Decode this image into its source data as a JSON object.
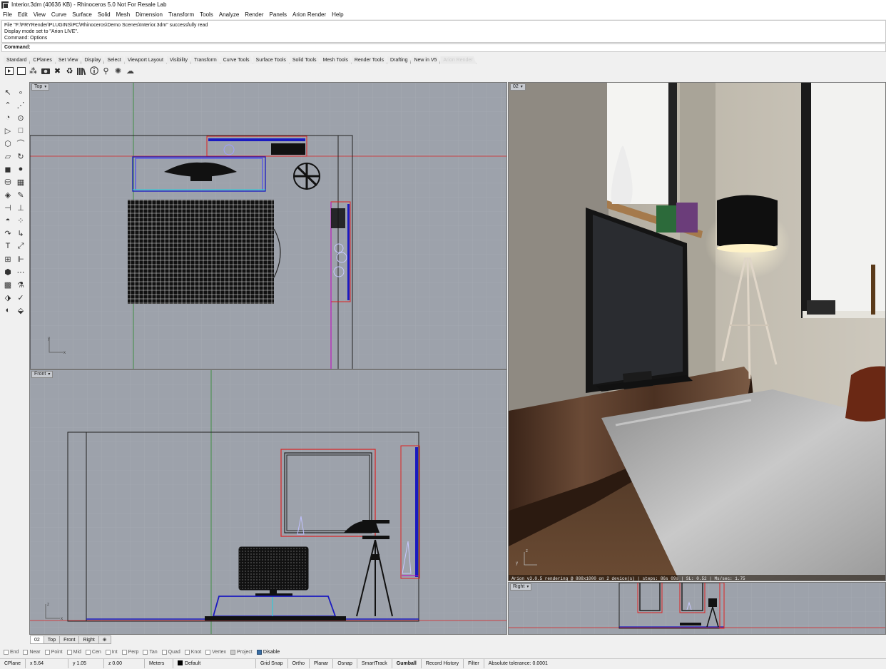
{
  "window": {
    "title": "Interior.3dm (40636 KB) - Rhinoceros 5.0 Not For Resale Lab"
  },
  "menu": [
    "File",
    "Edit",
    "View",
    "Curve",
    "Surface",
    "Solid",
    "Mesh",
    "Dimension",
    "Transform",
    "Tools",
    "Analyze",
    "Render",
    "Panels",
    "Arion Render",
    "Help"
  ],
  "command_history": [
    "File \"F:\\FRYRender\\PLUGINS\\PC\\Rhinoceros\\Demo Scenes\\Interior.3dm\" successfully read",
    "Display mode set to \"Arion LIVE\".",
    "Command: Options"
  ],
  "command_prompt": "Command:",
  "toolbar_tabs": [
    "Standard",
    "CPlanes",
    "Set View",
    "Display",
    "Select",
    "Viewport Layout",
    "Visibility",
    "Transform",
    "Curve Tools",
    "Surface Tools",
    "Solid Tools",
    "Mesh Tools",
    "Render Tools",
    "Drafting",
    "New in V5",
    "Arion Render"
  ],
  "viewports": {
    "top": {
      "label": "Top"
    },
    "front": {
      "label": "Front"
    },
    "perspective": {
      "label": "02"
    },
    "right": {
      "label": "Right"
    }
  },
  "render_status": "Arion v3.0.5 rendering @ 888x1000 on 2 device(s) | steps: 86s 09s | SL: 0.52 | Ms/sec: 1.75",
  "viewport_tabs": [
    "02",
    "Top",
    "Front",
    "Right"
  ],
  "osnaps": [
    {
      "label": "End",
      "on": false
    },
    {
      "label": "Near",
      "on": false
    },
    {
      "label": "Point",
      "on": false
    },
    {
      "label": "Mid",
      "on": false
    },
    {
      "label": "Cen",
      "on": false
    },
    {
      "label": "Int",
      "on": false
    },
    {
      "label": "Perp",
      "on": false
    },
    {
      "label": "Tan",
      "on": false
    },
    {
      "label": "Quad",
      "on": false
    },
    {
      "label": "Knot",
      "on": false
    },
    {
      "label": "Vertex",
      "on": false
    },
    {
      "label": "Project",
      "on": false
    },
    {
      "label": "Disable",
      "on": true
    }
  ],
  "status": {
    "cplane": "CPlane",
    "x": "x 5.64",
    "y": "y 1.05",
    "z": "z 0.00",
    "units": "Meters",
    "layer": "Default",
    "grid_snap": "Grid Snap",
    "ortho": "Ortho",
    "planar": "Planar",
    "osnap": "Osnap",
    "smarttrack": "SmartTrack",
    "gumball": "Gumball",
    "record_history": "Record History",
    "filter": "Filter",
    "tolerance": "Absolute tolerance: 0.0001"
  },
  "colors": {
    "viewport_bg": "#9da2ab",
    "selection": "#ff0000",
    "object": "#0000cc"
  }
}
